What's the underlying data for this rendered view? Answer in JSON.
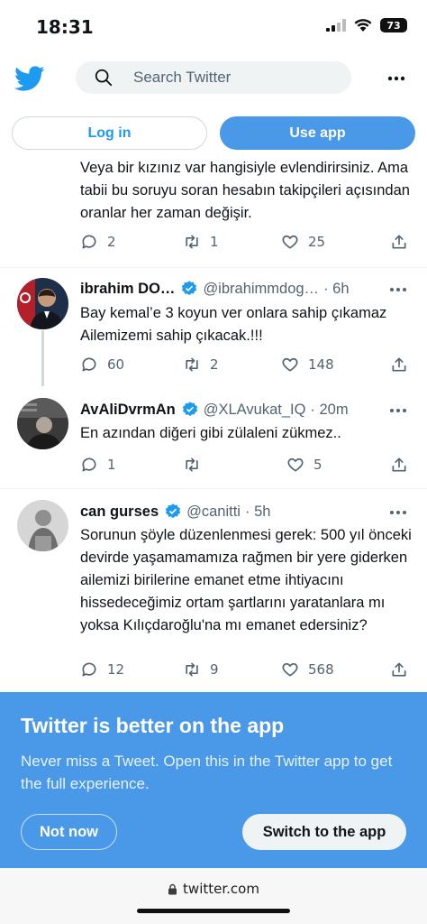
{
  "status_bar": {
    "time": "18:31",
    "battery": "73"
  },
  "header": {
    "search_placeholder": "Search Twitter"
  },
  "auth": {
    "login_label": "Log in",
    "use_app_label": "Use app"
  },
  "tweets": [
    {
      "text": "Veya bir kızınız var hangisiyle evlendirirsiniz. Ama tabii bu soruyu soran hesabın takipçileri açısından oranlar her zaman değişir.",
      "replies": "2",
      "retweets": "1",
      "likes": "25"
    },
    {
      "name": "ibrahim DO…",
      "handle": "@ibrahimmdog…",
      "time": "· 6h",
      "text": "Bay kemal’e 3 koyun ver onlara sahip çıkamaz Ailemizemi sahip çıkacak.!!!",
      "replies": "60",
      "retweets": "2",
      "likes": "148"
    },
    {
      "name": "AvAliDvrmAn",
      "handle": "@XLAvukat_IQ",
      "time": "· 20m",
      "text": "En azından diğeri gibi zülaleni zükmez..",
      "replies": "1",
      "retweets": "",
      "likes": "5"
    },
    {
      "name": "can gurses",
      "handle": "@canitti",
      "time": "· 5h",
      "text": "Sorunun şöyle düzenlenmesi gerek: 500 yıl önceki devirde yaşamamamıza rağmen bir yere giderken ailemizi birilerine emanet etme ihtiyacını hissedeceğimiz ortam şartlarını yaratanlara mı yoksa Kılıçdaroğlu'na mı emanet edersiniz?",
      "replies": "12",
      "retweets": "9",
      "likes": "568"
    }
  ],
  "banner": {
    "title": "Twitter is better on the app",
    "subtitle": "Never miss a Tweet. Open this in the Twitter app to get the full experience.",
    "not_now_label": "Not now",
    "switch_label": "Switch to the app"
  },
  "browser": {
    "url": "twitter.com"
  },
  "colors": {
    "brand": "#1d9bf0",
    "banner": "#4a99e9",
    "muted": "#536471"
  }
}
